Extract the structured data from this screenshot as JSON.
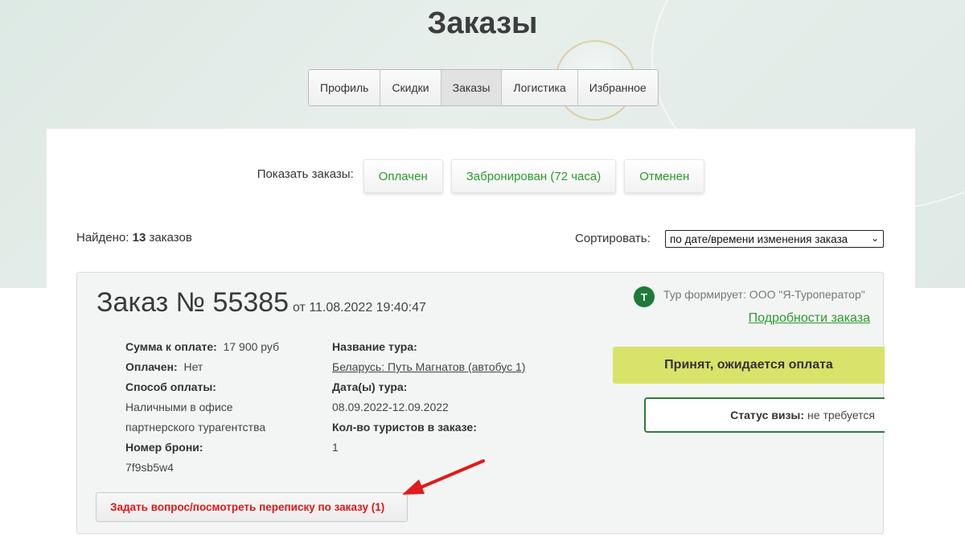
{
  "page": {
    "title": "Заказы"
  },
  "tabs": [
    {
      "label": "Профиль",
      "active": false
    },
    {
      "label": "Скидки",
      "active": false
    },
    {
      "label": "Заказы",
      "active": true
    },
    {
      "label": "Логистика",
      "active": false
    },
    {
      "label": "Избранное",
      "active": false
    }
  ],
  "filter": {
    "label": "Показать заказы:",
    "buttons": [
      "Оплачен",
      "Забронирован (72 часа)",
      "Отменен"
    ]
  },
  "results": {
    "found_prefix": "Найдено:",
    "count": "13",
    "found_suffix": "заказов"
  },
  "sort": {
    "label": "Сортировать:",
    "selected": "по дате/времени изменения заказа"
  },
  "order": {
    "title": "Заказ № 55385",
    "date": "от 11.08.2022 19:40:47",
    "operator_logo": "Т",
    "operator_text": "Тур формирует: ООО \"Я-Туроператор\"",
    "details_link": "Подробности заказа",
    "sum_label": "Сумма к оплате:",
    "sum_value": "17 900 руб",
    "paid_label": "Оплачен:",
    "paid_value": "Нет",
    "payment_label": "Способ оплаты:",
    "payment_value_line1": "Наличными в офисе",
    "payment_value_line2": "партнерского турагентства",
    "booking_label": "Номер брони:",
    "booking_value": "7f9sb5w4",
    "tour_label": "Название тура:",
    "tour_value": "Беларусь: Путь Магнатов (автобус 1)",
    "dates_label": "Дата(ы) тура:",
    "dates_value": "08.09.2022-12.09.2022",
    "tourists_label": "Кол-во туристов в заказе:",
    "tourists_value": "1",
    "status": "Принят, ожидается оплата",
    "visa_label": "Статус визы:",
    "visa_value": "не требуется",
    "ask_button": "Задать вопрос/посмотреть переписку по заказу (1)"
  },
  "colors": {
    "accent_green": "#2b9a2e",
    "status_yellow": "#d8e36a",
    "visa_border": "#2f7a3a",
    "alert_red": "#e01616"
  }
}
